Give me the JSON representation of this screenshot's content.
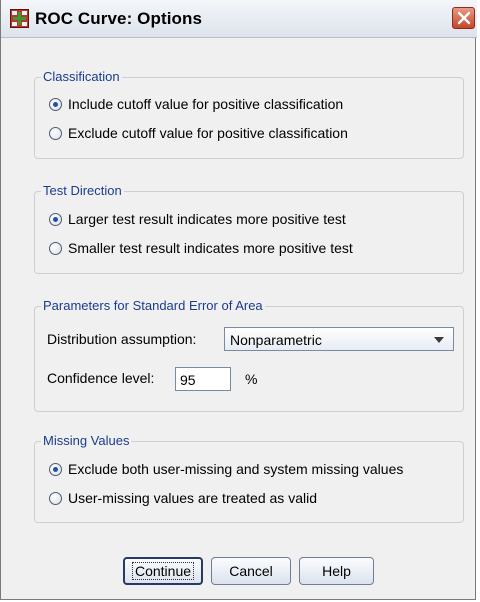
{
  "window": {
    "title": "ROC Curve: Options"
  },
  "classification": {
    "legend": "Classification",
    "options": [
      {
        "label": "Include cutoff value for positive classification",
        "checked": true
      },
      {
        "label": "Exclude cutoff value for positive classification",
        "checked": false
      }
    ]
  },
  "test_direction": {
    "legend": "Test Direction",
    "options": [
      {
        "label": "Larger test result indicates more positive test",
        "checked": true
      },
      {
        "label": "Smaller test result indicates more positive test",
        "checked": false
      }
    ]
  },
  "std_error": {
    "legend": "Parameters for Standard Error of Area",
    "distribution_label": "Distribution assumption:",
    "distribution_value": "Nonparametric",
    "confidence_label": "Confidence level:",
    "confidence_value": "95",
    "unit": "%"
  },
  "missing_values": {
    "legend": "Missing Values",
    "options": [
      {
        "label": "Exclude both user-missing and system missing values",
        "checked": true
      },
      {
        "label": "User-missing values are treated as valid",
        "checked": false
      }
    ]
  },
  "buttons": {
    "continue": "Continue",
    "cancel": "Cancel",
    "help": "Help"
  }
}
